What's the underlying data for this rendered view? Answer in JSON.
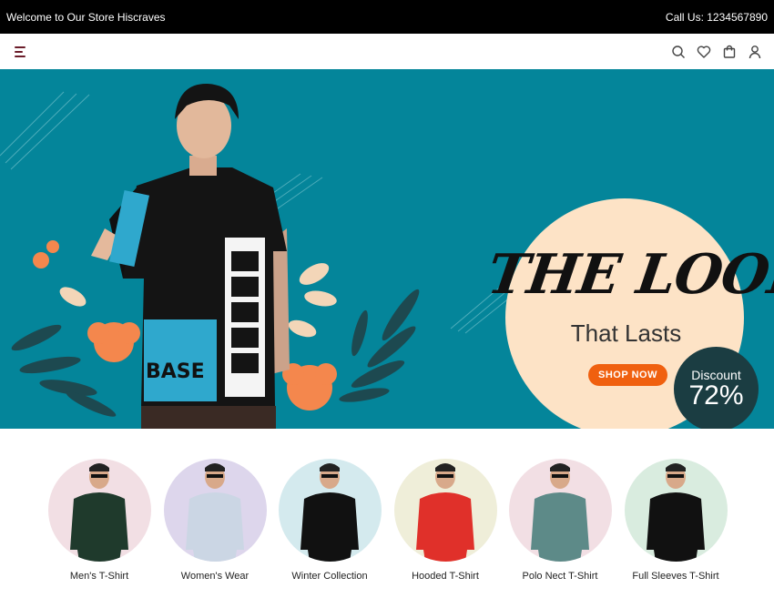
{
  "topbar": {
    "welcome": "Welcome to Our Store Hiscraves",
    "phone": "Call Us: 1234567890"
  },
  "nav": {
    "icons": [
      "menu-icon",
      "search-icon",
      "heart-icon",
      "cart-icon",
      "user-icon"
    ]
  },
  "hero": {
    "headline": "THE LOOK",
    "subheadline": "That Lasts",
    "cta": "SHOP NOW",
    "discount_label": "Discount",
    "discount_value": "72%",
    "shirt_text": "BASE",
    "colors": {
      "background": "#04859a",
      "accent": "#f0600f",
      "cream": "#fde3c6",
      "badge": "#1b3d42"
    }
  },
  "categories": [
    {
      "label": "Men's T-Shirt",
      "bg": "#f2dfe4",
      "shirt": "#1f3a2c"
    },
    {
      "label": "Women's Wear",
      "bg": "#ddd6ec",
      "shirt": "#cbd6e4"
    },
    {
      "label": "Winter Collection",
      "bg": "#d4eaee",
      "shirt": "#111111"
    },
    {
      "label": "Hooded T-Shirt",
      "bg": "#efeed9",
      "shirt": "#e0302a"
    },
    {
      "label": "Polo Nect T-Shirt",
      "bg": "#f2dfe4",
      "shirt": "#5d8a88"
    },
    {
      "label": "Full Sleeves T-Shirt",
      "bg": "#d9ecdf",
      "shirt": "#111111"
    }
  ]
}
